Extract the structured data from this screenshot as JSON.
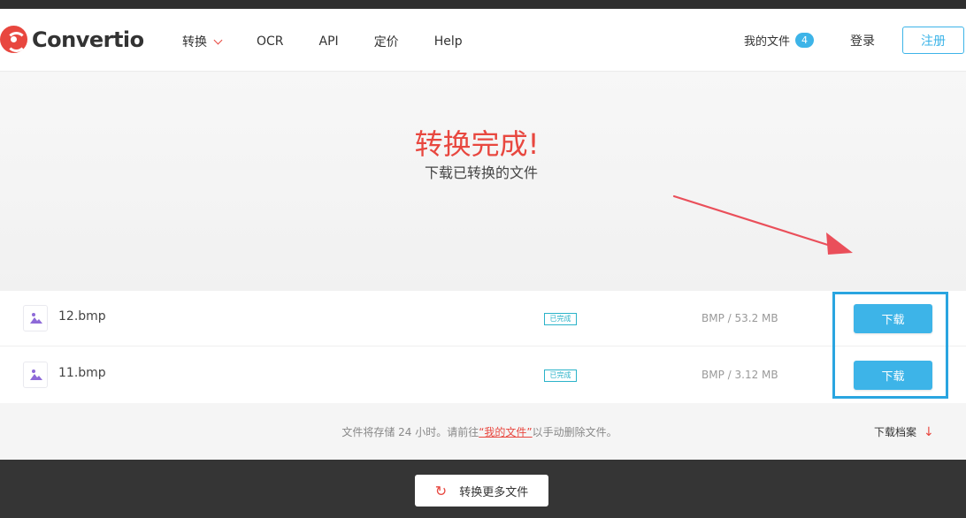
{
  "header": {
    "logo_text": "Convertio",
    "nav": [
      "转换",
      "OCR",
      "API",
      "定价",
      "Help"
    ],
    "my_files_label": "我的文件",
    "my_files_count": "4",
    "login_label": "登录",
    "register_label": "注册"
  },
  "hero": {
    "title": "转换完成!",
    "subtitle": "下载已转换的文件"
  },
  "files": [
    {
      "name": "12.bmp",
      "status": "已完成",
      "size": "BMP / 53.2 MB",
      "download_label": "下载"
    },
    {
      "name": "11.bmp",
      "status": "已完成",
      "size": "BMP / 3.12 MB",
      "download_label": "下载"
    }
  ],
  "info": {
    "text_before": "文件将存储 24 小时。请前往",
    "link_text": "“我的文件”",
    "text_after": "以手动删除文件。",
    "archive_label": "下载档案"
  },
  "footer": {
    "convert_more_label": "转换更多文件"
  },
  "colors": {
    "brand_red": "#e8473f",
    "accent_blue": "#3db4e8",
    "status_teal": "#2bb3c9"
  }
}
